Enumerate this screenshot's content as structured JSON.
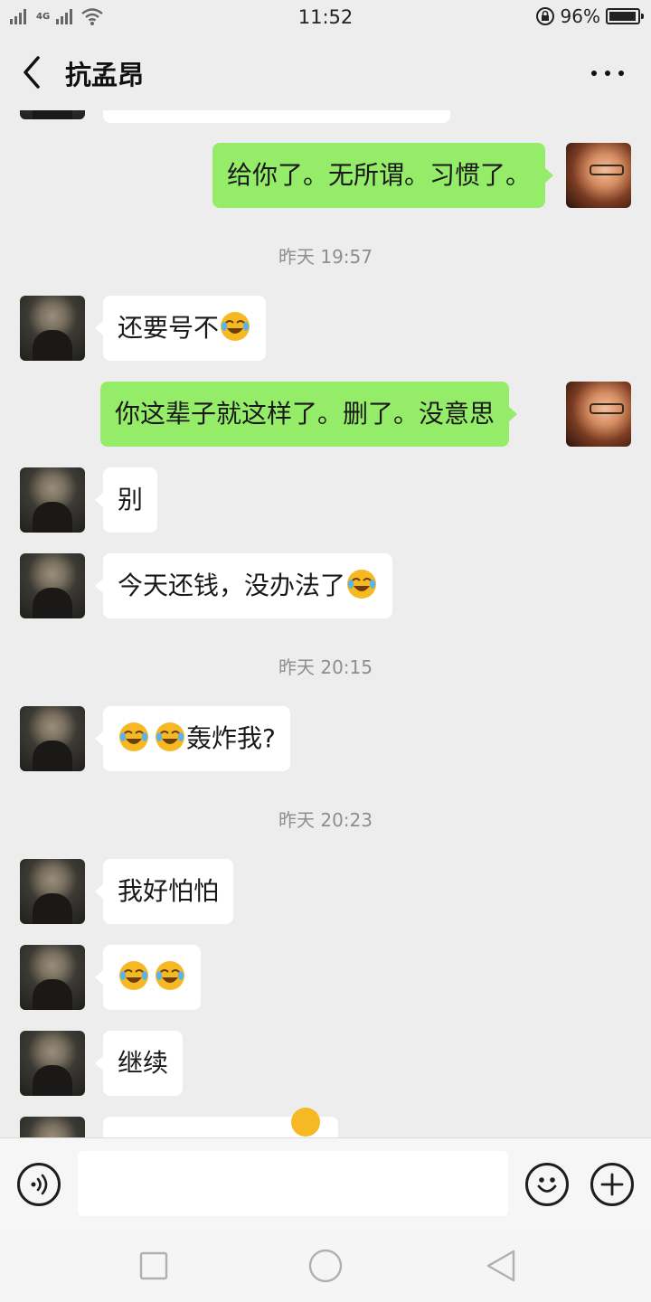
{
  "status_bar": {
    "signal_left": "4G",
    "time": "11:52",
    "battery": "96%",
    "battery_level": 0.96
  },
  "header": {
    "title": "抗孟昂",
    "back_icon": "chevron-left-icon",
    "more_icon": "more-dots-icon"
  },
  "messages": [
    {
      "side": "out",
      "text": "给你了。无所谓。习惯了。"
    },
    {
      "type": "time",
      "text": "昨天 19:57"
    },
    {
      "side": "in",
      "text": "还要号不",
      "emoji": "face-with-tears-of-joy"
    },
    {
      "side": "out",
      "text": "你这辈子就这样了。删了。没意思"
    },
    {
      "side": "in",
      "text": "别"
    },
    {
      "side": "in",
      "text": "今天还钱，没办法了",
      "emoji": "face-with-tears-of-joy"
    },
    {
      "type": "time",
      "text": "昨天 20:15"
    },
    {
      "side": "in",
      "text": "轰炸我?",
      "emoji_prefix": 2
    },
    {
      "type": "time",
      "text": "昨天 20:23"
    },
    {
      "side": "in",
      "text": "我好怕怕"
    },
    {
      "side": "in",
      "text": "",
      "emoji_count": 2
    },
    {
      "side": "in",
      "text": "继续"
    }
  ],
  "input_bar": {
    "voice_icon": "voice-icon",
    "emoji_icon": "smiley-icon",
    "plus_icon": "plus-icon",
    "value": ""
  },
  "system_nav": {
    "square": "recent-apps-icon",
    "circle": "home-icon",
    "triangle": "back-triangle-icon"
  },
  "colors": {
    "outgoing_bubble": "#95ec69",
    "incoming_bubble": "#ffffff",
    "background": "#ededed"
  }
}
